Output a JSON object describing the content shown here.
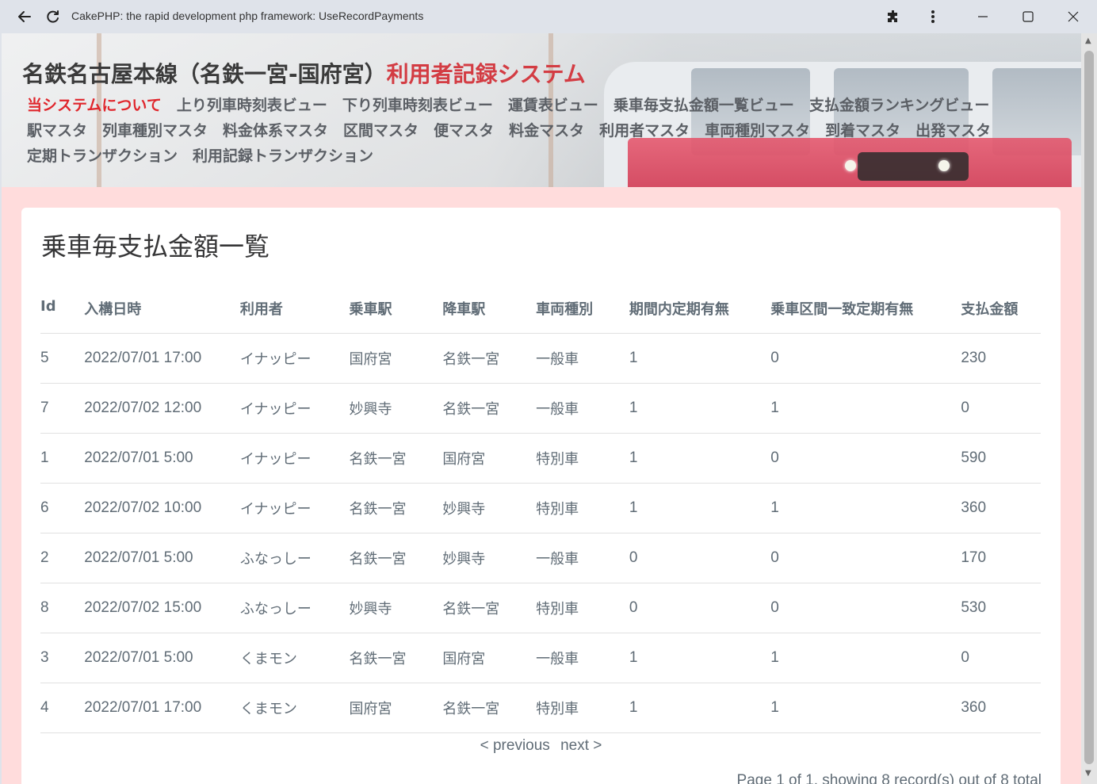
{
  "window": {
    "title": "CakePHP: the rapid development php framework: UseRecordPayments"
  },
  "header": {
    "title_main": "名鉄名古屋本線（名鉄一宮-国府宮）",
    "title_accent": "利用者記録システム",
    "nav_row1": [
      "当システムについて",
      "上り列車時刻表ビュー",
      "下り列車時刻表ビュー",
      "運賃表ビュー",
      "乗車毎支払金額一覧ビュー",
      "支払金額ランキングビュー"
    ],
    "nav_row2": [
      "駅マスタ",
      "列車種別マスタ",
      "料金体系マスタ",
      "区間マスタ",
      "便マスタ",
      "料金マスタ",
      "利用者マスタ",
      "車両種別マスタ",
      "到着マスタ",
      "出発マスタ"
    ],
    "nav_row3": [
      "定期トランザクション",
      "利用記録トランザクション"
    ]
  },
  "main": {
    "heading": "乗車毎支払金額一覧",
    "columns": [
      "Id",
      "入構日時",
      "利用者",
      "乗車駅",
      "降車駅",
      "車両種別",
      "期間内定期有無",
      "乗車区間一致定期有無",
      "支払金額"
    ],
    "rows": [
      [
        "5",
        "2022/07/01 17:00",
        "イナッピー",
        "国府宮",
        "名鉄一宮",
        "一般車",
        "1",
        "0",
        "230"
      ],
      [
        "7",
        "2022/07/02 12:00",
        "イナッピー",
        "妙興寺",
        "名鉄一宮",
        "一般車",
        "1",
        "1",
        "0"
      ],
      [
        "1",
        "2022/07/01 5:00",
        "イナッピー",
        "名鉄一宮",
        "国府宮",
        "特別車",
        "1",
        "0",
        "590"
      ],
      [
        "6",
        "2022/07/02 10:00",
        "イナッピー",
        "名鉄一宮",
        "妙興寺",
        "特別車",
        "1",
        "1",
        "360"
      ],
      [
        "2",
        "2022/07/01 5:00",
        "ふなっしー",
        "名鉄一宮",
        "妙興寺",
        "一般車",
        "0",
        "0",
        "170"
      ],
      [
        "8",
        "2022/07/02 15:00",
        "ふなっしー",
        "妙興寺",
        "名鉄一宮",
        "特別車",
        "0",
        "0",
        "530"
      ],
      [
        "3",
        "2022/07/01 5:00",
        "くまモン",
        "名鉄一宮",
        "国府宮",
        "一般車",
        "1",
        "1",
        "0"
      ],
      [
        "4",
        "2022/07/01 17:00",
        "くまモン",
        "国府宮",
        "名鉄一宮",
        "特別車",
        "1",
        "1",
        "360"
      ]
    ],
    "pager": {
      "previous": "< previous",
      "next": "next >"
    },
    "counter": "Page 1 of 1, showing 8 record(s) out of 8 total"
  }
}
